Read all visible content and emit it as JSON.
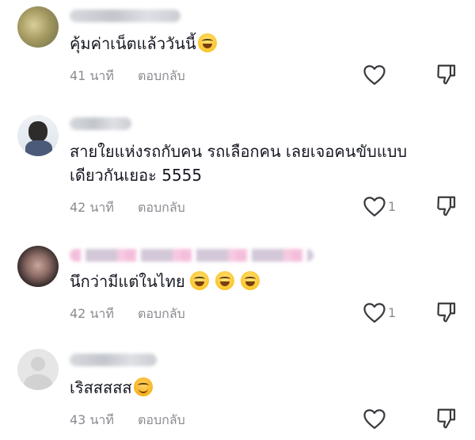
{
  "comments": [
    {
      "text": "คุ้มค่าเน็ตแล้ววันนี้",
      "emojis": [
        "tears-of-joy-emoji"
      ],
      "time": "41 นาที",
      "reply_label": "ตอบกลับ",
      "likes": ""
    },
    {
      "text_line1": "สายใยแห่งรถกับคน รถเลือกคน เลยเจอคนขับแบบ",
      "text_line2": "เดียวกันเยอะ 5555",
      "time": "42 นาที",
      "reply_label": "ตอบกลับ",
      "likes": "1"
    },
    {
      "text": "นึกว่ามีแต่ในไทย",
      "emojis": [
        "grinning-sweat-emoji",
        "grinning-sweat-emoji",
        "grinning-sweat-emoji"
      ],
      "time": "42 นาที",
      "reply_label": "ตอบกลับ",
      "likes": "1"
    },
    {
      "text": "เริสสสสส",
      "emojis": [
        "smiling-face-with-hearts-emoji"
      ],
      "time": "43 นาที",
      "reply_label": "ตอบกลับ",
      "likes": ""
    }
  ],
  "icons": {
    "like": "heart-outline-icon",
    "dislike": "thumbs-down-outline-icon"
  },
  "colors": {
    "text": "#161823",
    "meta": "#8a8b91",
    "icon": "#3a3a3f"
  }
}
